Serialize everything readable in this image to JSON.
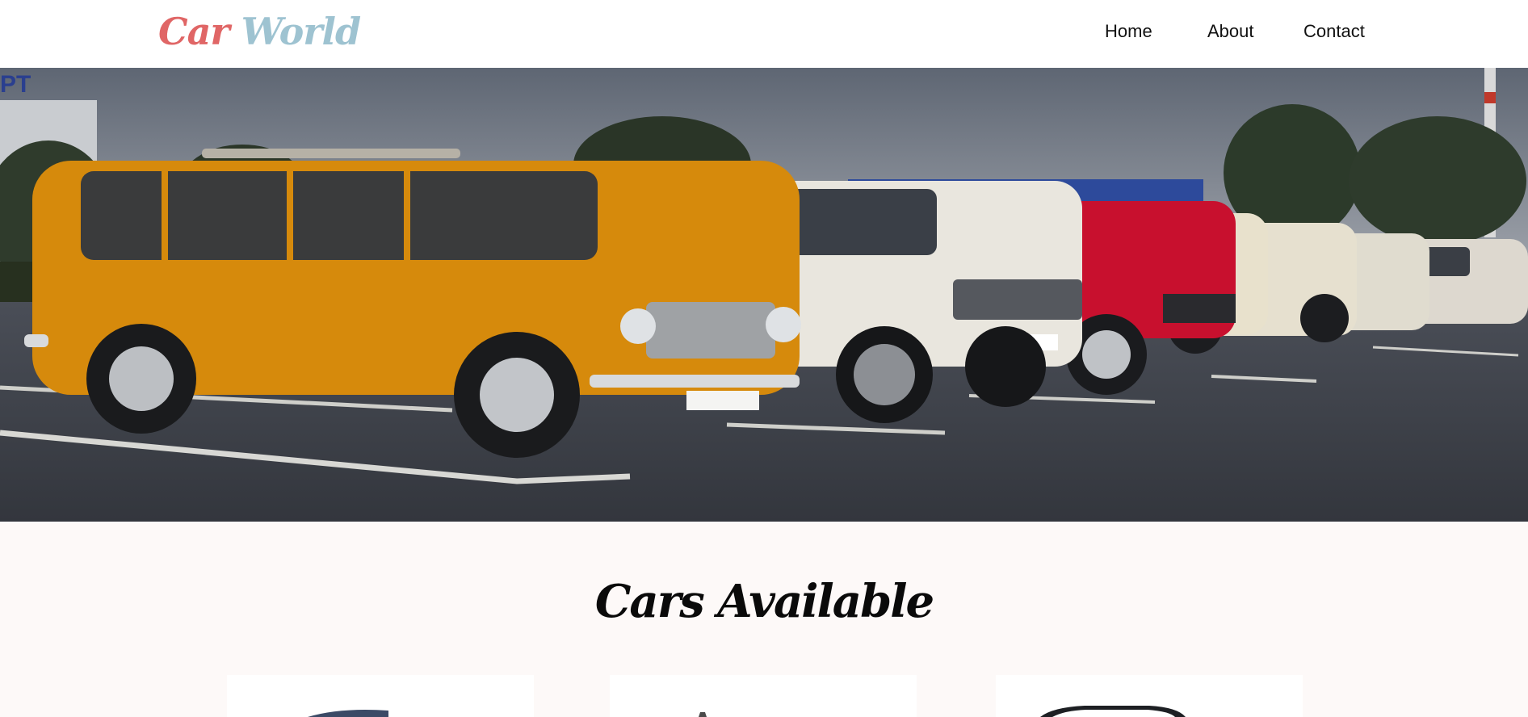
{
  "nav": {
    "logo_first": "Car",
    "logo_second": "World",
    "links": [
      {
        "label": "Home"
      },
      {
        "label": "About"
      },
      {
        "label": "Contact"
      }
    ]
  },
  "hero": {
    "image": "vintage-cars-parking-lot-photo"
  },
  "cars": {
    "title": "Cars Available",
    "cards": [
      {
        "image": "blue-car-photo"
      },
      {
        "image": "silver-car-photo"
      },
      {
        "image": "dark-car-photo"
      }
    ]
  },
  "colors": {
    "logo_red": "#e06666",
    "logo_blue": "#9ec3d1",
    "page_background": "#fdf9f8"
  }
}
